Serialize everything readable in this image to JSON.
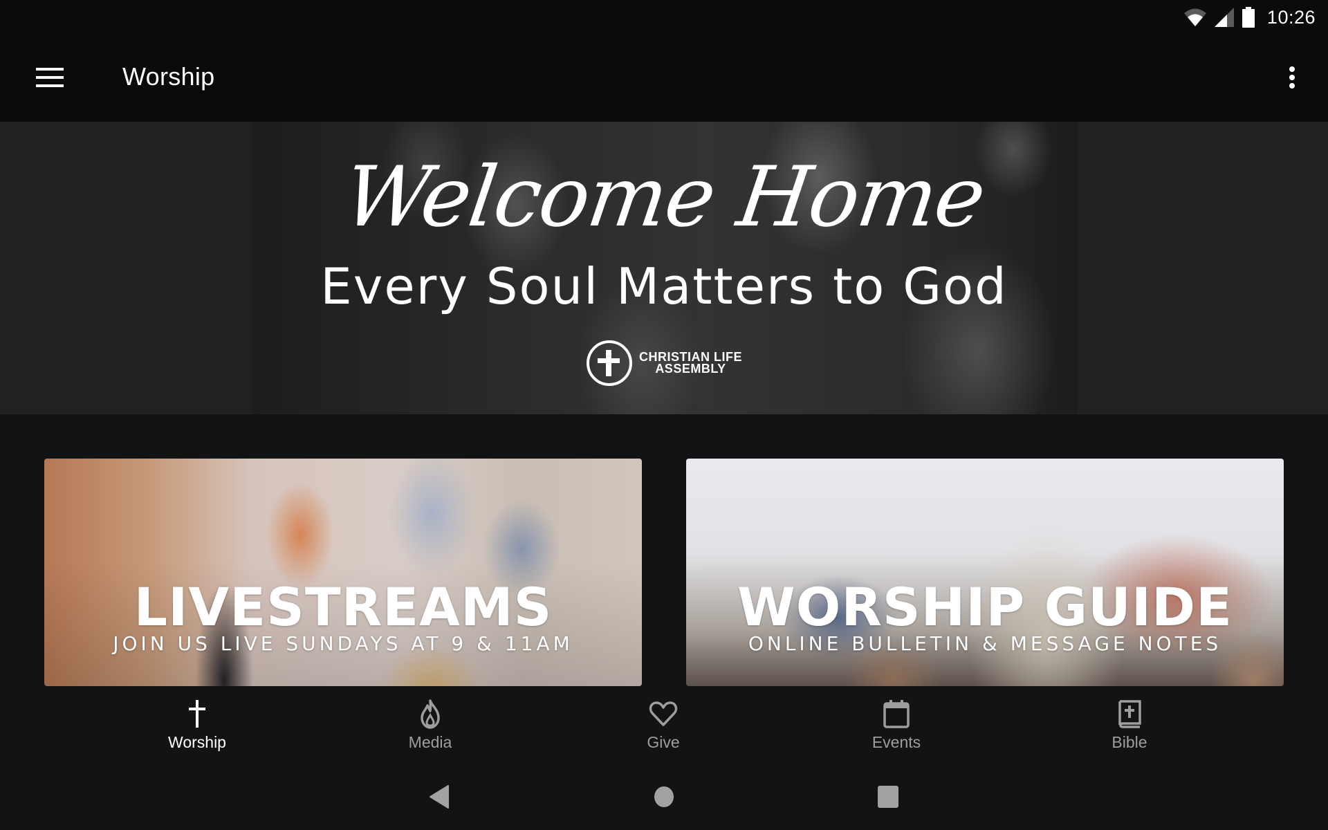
{
  "status_bar": {
    "time": "10:26",
    "icons": [
      "wifi-icon",
      "cell-signal-icon",
      "battery-icon"
    ]
  },
  "app_bar": {
    "title": "Worship",
    "menu_icon": "hamburger-menu-icon",
    "overflow_icon": "more-vert-icon"
  },
  "hero": {
    "script_title": "Welcome Home",
    "tagline": "Every Soul Matters to God",
    "logo_line1": "CHRISTIAN LIFE",
    "logo_line2": "ASSEMBLY"
  },
  "cards": [
    {
      "title": "LIVESTREAMS",
      "subtitle": "JOIN US LIVE SUNDAYS AT 9 & 11AM"
    },
    {
      "title": "WORSHIP GUIDE",
      "subtitle": "ONLINE BULLETIN & MESSAGE NOTES"
    }
  ],
  "bottom_nav": {
    "items": [
      {
        "label": "Worship",
        "icon": "cross-icon",
        "active": true
      },
      {
        "label": "Media",
        "icon": "flame-icon",
        "active": false
      },
      {
        "label": "Give",
        "icon": "heart-icon",
        "active": false
      },
      {
        "label": "Events",
        "icon": "calendar-icon",
        "active": false
      },
      {
        "label": "Bible",
        "icon": "bible-icon",
        "active": false
      }
    ]
  },
  "system_nav": {
    "buttons": [
      "back-icon",
      "home-icon",
      "recents-icon"
    ]
  },
  "colors": {
    "background": "#121315",
    "app_bar": "#0b0b0b",
    "hero_bg": "#212121",
    "nav_active": "#ffffff",
    "nav_inactive": "#9e9e9e"
  }
}
